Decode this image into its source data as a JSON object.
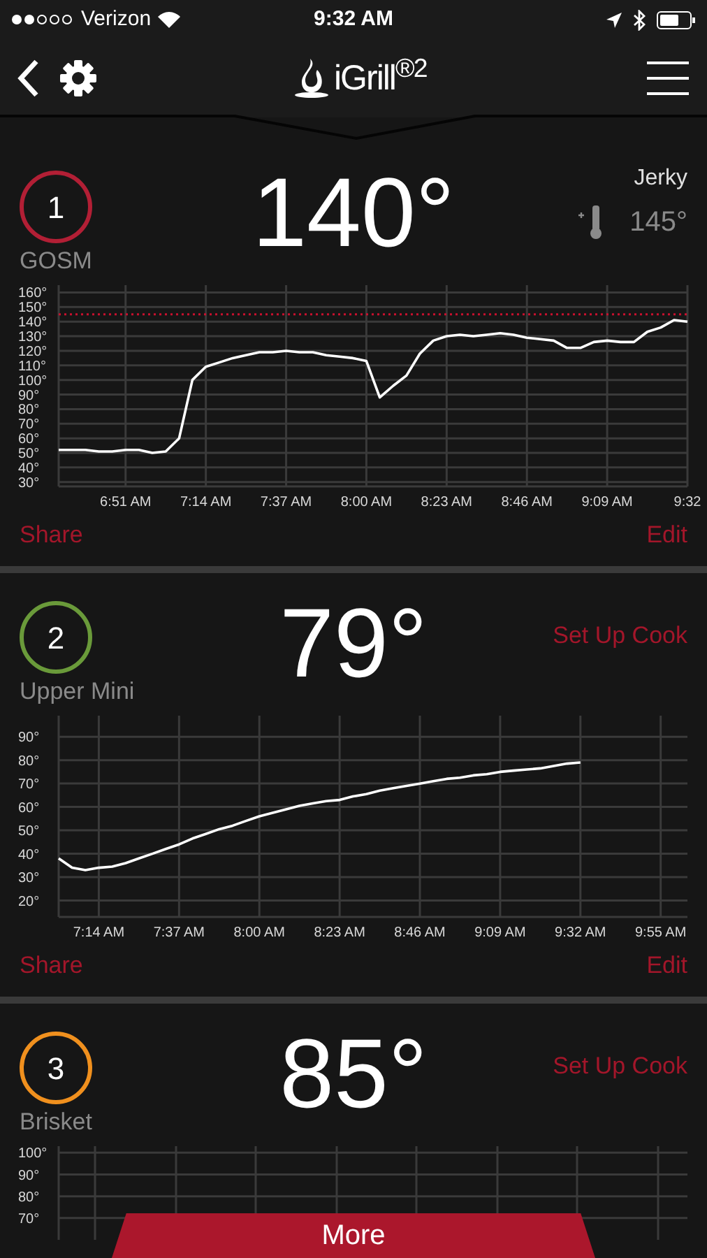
{
  "status_bar": {
    "carrier": "Verizon",
    "time": "9:32 AM"
  },
  "nav": {
    "logo": "iGrill$^{®2}$"
  },
  "probes": [
    {
      "number": "1",
      "color": "#b21f35",
      "name": "GOSM",
      "temperature": "140°",
      "kind": "target",
      "target_label": "Jerky",
      "target_value": "145°",
      "share": "Share",
      "edit": "Edit",
      "chart_data": {
        "type": "line",
        "ylim": [
          27,
          165
        ],
        "yticks": [
          {
            "value": 30,
            "label": "30°"
          },
          {
            "value": 40,
            "label": "40°"
          },
          {
            "value": 50,
            "label": "50°"
          },
          {
            "value": 60,
            "label": "60°"
          },
          {
            "value": 70,
            "label": "70°"
          },
          {
            "value": 80,
            "label": "80°"
          },
          {
            "value": 90,
            "label": "90°"
          },
          {
            "value": 100,
            "label": "100°"
          },
          {
            "value": 110,
            "label": "110°"
          },
          {
            "value": 120,
            "label": "120°"
          },
          {
            "value": 130,
            "label": "130°"
          },
          {
            "value": 140,
            "label": "140°"
          },
          {
            "value": 150,
            "label": "150°"
          },
          {
            "value": 160,
            "label": "160°"
          }
        ],
        "categories": [
          null,
          null,
          null,
          null,
          null,
          "6:51 AM",
          null,
          null,
          null,
          null,
          null,
          "7:14 AM",
          null,
          null,
          null,
          null,
          null,
          "7:37 AM",
          null,
          null,
          null,
          null,
          null,
          "8:00 AM",
          null,
          null,
          null,
          null,
          null,
          "8:23 AM",
          null,
          null,
          null,
          null,
          null,
          "8:46 AM",
          null,
          null,
          null,
          null,
          null,
          "9:09 AM",
          null,
          null,
          null,
          null,
          null,
          "9:32"
        ],
        "series": [
          {
            "color": "#ffffff",
            "values": [
              52,
              52,
              52,
              51,
              51,
              52,
              52,
              50,
              51,
              60,
              100,
              109,
              112,
              115,
              117,
              119,
              119,
              120,
              119,
              119,
              117,
              116,
              115,
              113,
              88,
              96,
              103,
              118,
              127,
              130,
              131,
              130,
              131,
              132,
              131,
              129,
              128,
              127,
              122,
              122,
              126,
              127,
              126,
              126,
              133,
              136,
              141,
              140
            ]
          }
        ],
        "ref_lines": [
          {
            "axis": "y",
            "value": 145
          }
        ],
        "grid": true
      }
    },
    {
      "number": "2",
      "color": "#6a9a3a",
      "name": "Upper Mini",
      "temperature": "79°",
      "kind": "setup",
      "action": "Set Up Cook",
      "share": "Share",
      "edit": "Edit",
      "chart_data": {
        "type": "line",
        "ylim": [
          13,
          99
        ],
        "yticks": [
          {
            "value": 20,
            "label": "20°"
          },
          {
            "value": 30,
            "label": "30°"
          },
          {
            "value": 40,
            "label": "40°"
          },
          {
            "value": 50,
            "label": "50°"
          },
          {
            "value": 60,
            "label": "60°"
          },
          {
            "value": 70,
            "label": "70°"
          },
          {
            "value": 80,
            "label": "80°"
          },
          {
            "value": 90,
            "label": "90°"
          }
        ],
        "categories": [
          null,
          null,
          null,
          "7:14 AM",
          null,
          null,
          null,
          null,
          null,
          "7:37 AM",
          null,
          null,
          null,
          null,
          null,
          "8:00 AM",
          null,
          null,
          null,
          null,
          null,
          "8:23 AM",
          null,
          null,
          null,
          null,
          null,
          "8:46 AM",
          null,
          null,
          null,
          null,
          null,
          "9:09 AM",
          null,
          null,
          null,
          null,
          null,
          "9:32 AM",
          null,
          null,
          null,
          null,
          null,
          "9:55 AM",
          null,
          null
        ],
        "series": [
          {
            "color": "#ffffff",
            "values": [
              38,
              34,
              33,
              34,
              34.5,
              36,
              38,
              40,
              42,
              44,
              46.5,
              48.5,
              50.5,
              52,
              54,
              56,
              57.5,
              59,
              60.5,
              61.5,
              62.5,
              63,
              64.5,
              65.5,
              67,
              68,
              69,
              70,
              71,
              72,
              72.5,
              73.5,
              74,
              75,
              75.5,
              76,
              76.5,
              77.5,
              78.5,
              79,
              null,
              null,
              null,
              null,
              null,
              null,
              null,
              null
            ]
          }
        ],
        "grid": true
      }
    },
    {
      "number": "3",
      "color": "#f0901e",
      "name": "Brisket",
      "temperature": "85°",
      "kind": "setup",
      "action": "Set Up Cook",
      "chart_data": {
        "type": "line",
        "grid": true,
        "categories": [
          null,
          null,
          null,
          null,
          null,
          null,
          null,
          null
        ],
        "ylim": [
          60,
          103
        ],
        "yticks": [
          {
            "value": 70,
            "label": "70°"
          },
          {
            "value": 80,
            "label": "80°"
          },
          {
            "value": 90,
            "label": "90°"
          },
          {
            "value": 100,
            "label": "100°"
          }
        ]
      }
    }
  ],
  "more_button": "More"
}
